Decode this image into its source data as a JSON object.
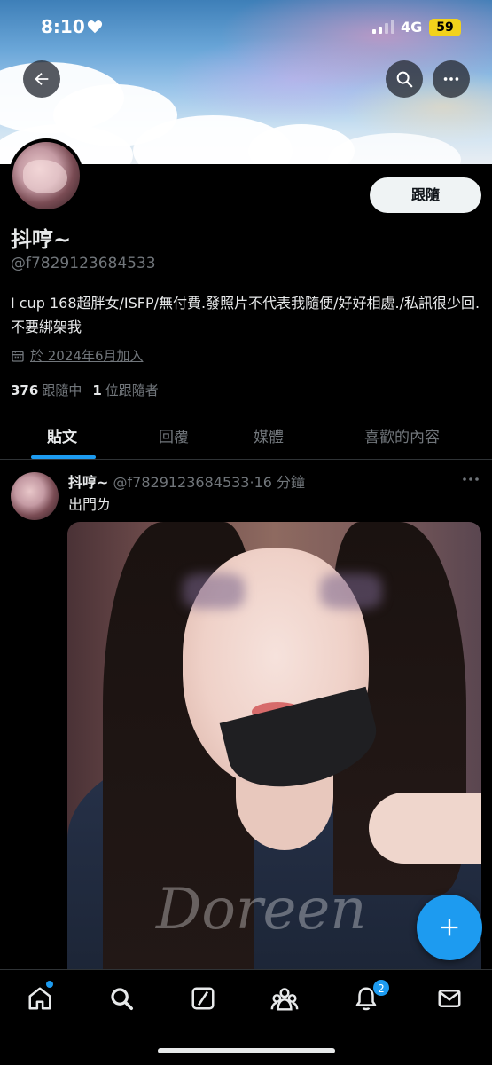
{
  "status_bar": {
    "time": "8:10",
    "network": "4G",
    "battery": "59"
  },
  "profile": {
    "follow_label": "跟隨",
    "display_name": "抖哼~",
    "handle": "@f7829123684533",
    "bio": "I cup 168超胖女/ISFP/無付費.發照片不代表我隨便/好好相處./私訊很少回.不要綁架我",
    "joined": "於 2024年6月加入",
    "following_count": "376",
    "following_label": "跟隨中",
    "followers_count": "1",
    "followers_label": "位跟隨者"
  },
  "tabs": [
    {
      "label": "貼文",
      "active": true
    },
    {
      "label": "回覆",
      "active": false
    },
    {
      "label": "媒體",
      "active": false
    },
    {
      "label": "喜歡的內容",
      "active": false
    }
  ],
  "post": {
    "author": "抖哼~",
    "handle": "@f7829123684533",
    "separator": "·",
    "time": "16 分鐘",
    "text": "出門ㄌ",
    "watermark": "Doreen"
  },
  "bottom_nav": {
    "items": [
      "home-icon",
      "search-icon",
      "grok-icon",
      "communities-icon",
      "notifications-icon",
      "messages-icon"
    ],
    "notification_count": "2"
  },
  "colors": {
    "accent": "#1d9bf0",
    "background": "#000000",
    "secondary_text": "#71767b",
    "primary_text": "#e7e9ea"
  }
}
